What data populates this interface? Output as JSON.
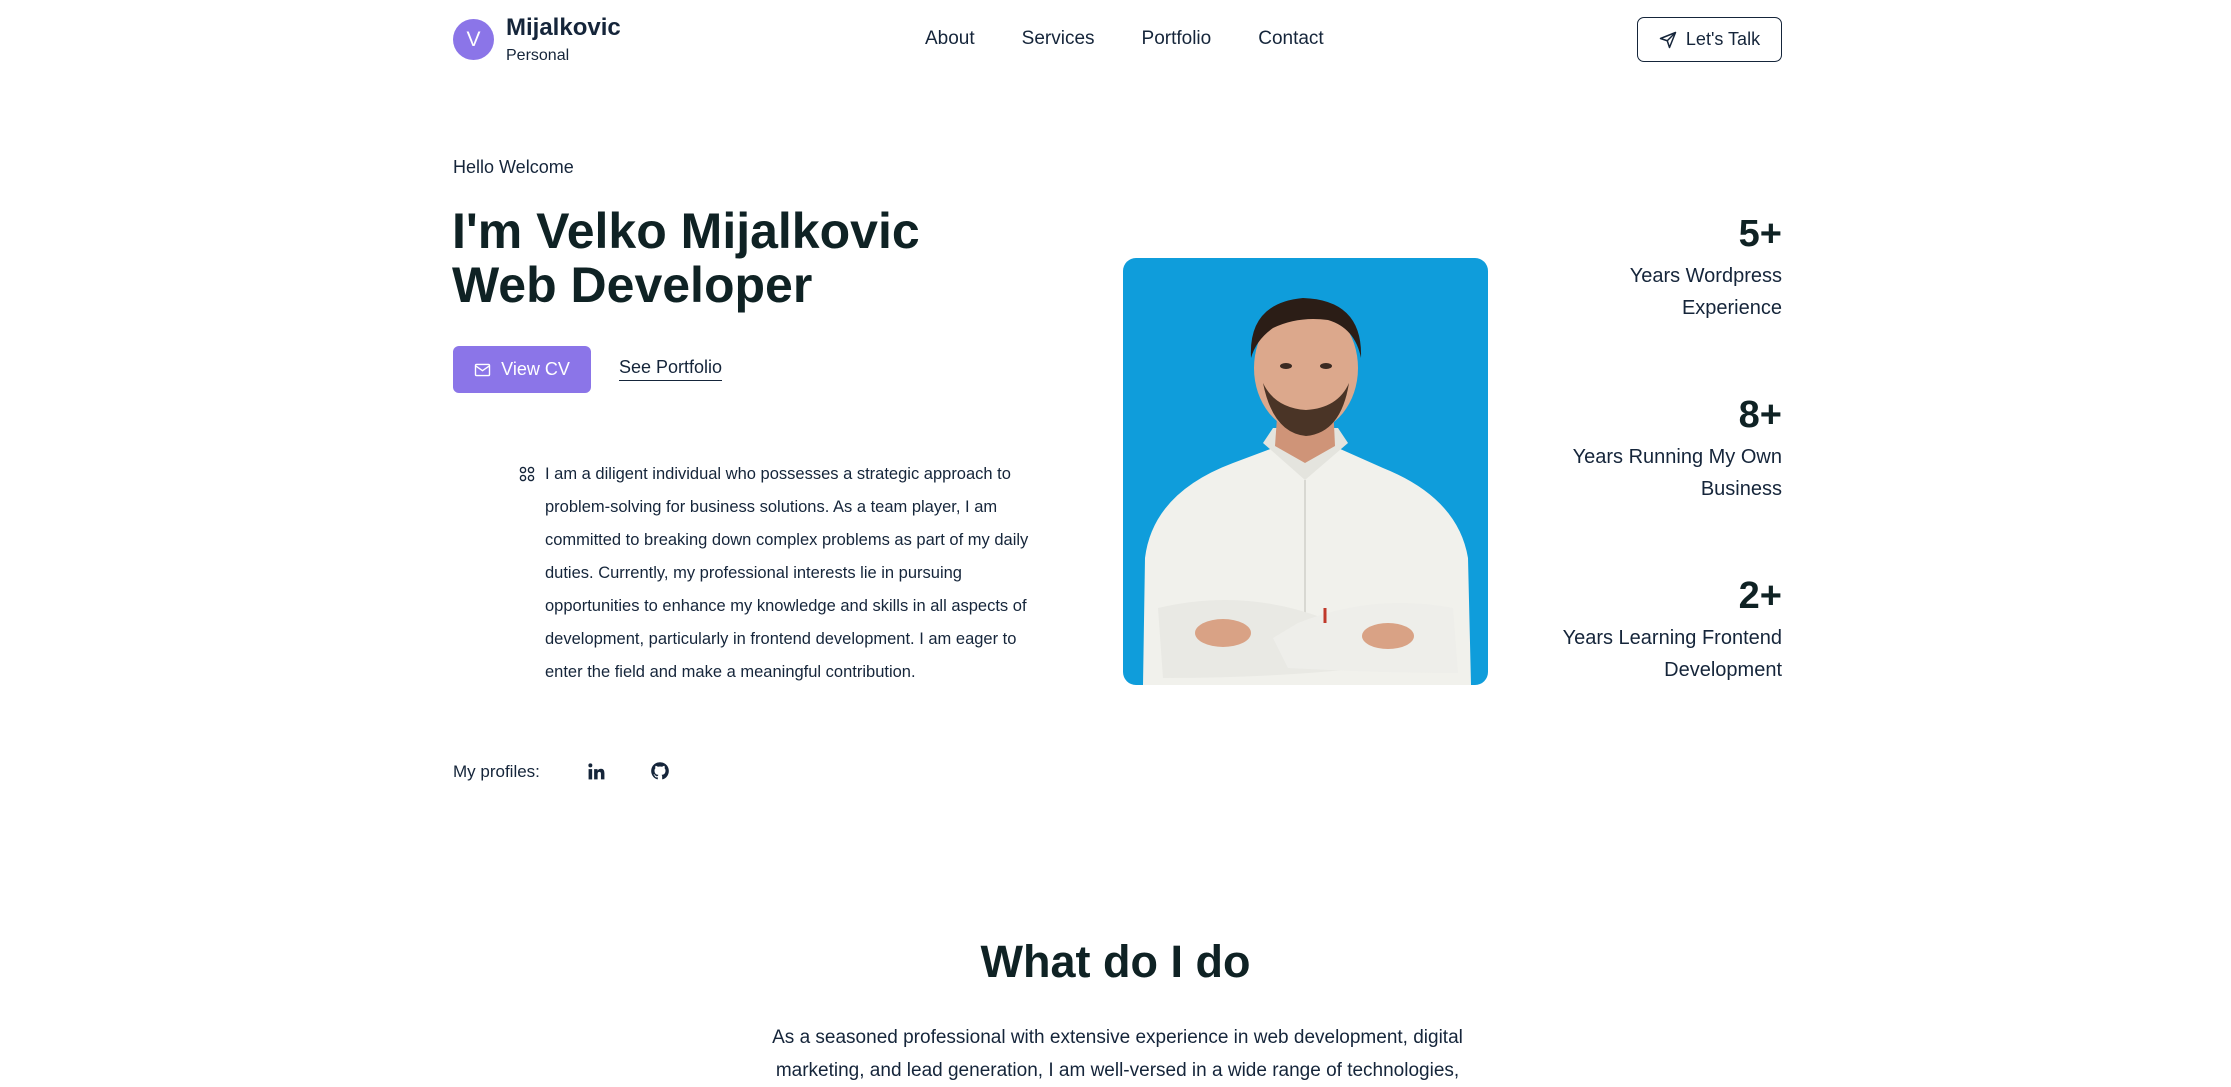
{
  "header": {
    "logo_letter": "V",
    "brand_name": "Mijalkovic",
    "brand_sub": "Personal",
    "nav": [
      "About",
      "Services",
      "Portfolio",
      "Contact"
    ],
    "cta_label": "Let's Talk",
    "cta_icon": "send-icon"
  },
  "hero": {
    "greeting": "Hello Welcome",
    "title_line1": "I'm Velko Mijalkovic",
    "title_line2": "Web Developer",
    "primary_button": "View CV",
    "primary_button_icon": "mail-icon",
    "secondary_link": "See Portfolio",
    "bio_icon": "grid-icon",
    "bio": "I am a diligent individual who possesses a strategic approach to problem-solving for business solutions. As a team player, I am committed to breaking down complex problems as part of my daily duties. Currently, my professional interests lie in pursuing opportunities to enhance my knowledge and skills in all aspects of development, particularly in frontend development. I am eager to enter the field and make a meaningful contribution."
  },
  "stats": [
    {
      "value": "5+",
      "label_line1": "Years Wordpress",
      "label_line2": "Experience"
    },
    {
      "value": "8+",
      "label_line1": "Years Running My Own",
      "label_line2": "Business"
    },
    {
      "value": "2+",
      "label_line1": "Years Learning Frontend",
      "label_line2": "Development"
    }
  ],
  "profiles": {
    "label": "My profiles:",
    "icons": [
      "linkedin-icon",
      "github-icon"
    ]
  },
  "services": {
    "title": "What do I do",
    "intro": "As a seasoned professional with extensive experience in web development, digital marketing, and lead generation, I am well-versed in a wide range of technologies,"
  },
  "colors": {
    "accent": "#8b75e8",
    "photo_bg": "#0f9ddb",
    "heading": "#0f2224",
    "text": "#15253a"
  }
}
